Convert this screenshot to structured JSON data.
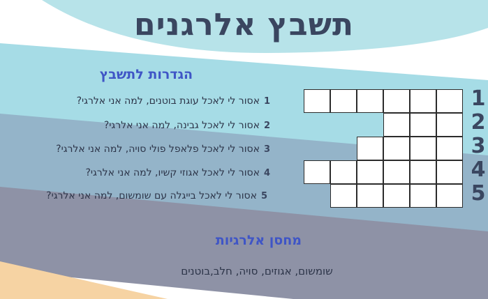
{
  "title": "תשבץ אלרגנים",
  "clues_heading": "הגדרות לתשבץ",
  "clues": [
    {
      "number": "1",
      "text": "אסור לי לאכל עוגת בוטנים, למה אני אלרגי?"
    },
    {
      "number": "2",
      "text": "אסור לי לאכל גבינה, למה אני אלרגי?"
    },
    {
      "number": "3",
      "text": "אסור לי לאכל פלאפל פולי סויה, למה אני אלרגי?"
    },
    {
      "number": "4",
      "text": "אסור לי לאכל אגוזי קשיו, למה אני אלרגי?"
    },
    {
      "number": "5",
      "text": "אסור לי לאכל בייגלה עם שומשום, למה אני אלרגי?"
    }
  ],
  "grid": {
    "columns": 6,
    "rows": [
      {
        "number": "1",
        "cells": 6
      },
      {
        "number": "2",
        "cells": 3
      },
      {
        "number": "3",
        "cells": 4
      },
      {
        "number": "4",
        "cells": 6
      },
      {
        "number": "5",
        "cells": 5
      }
    ]
  },
  "bank_heading": "מחסן אלרגיות",
  "bank_words": "שומשום, אגוזים, סויה, חלב,בוטנים",
  "colors": {
    "title": "#3a4660",
    "heading": "#3f55c6",
    "band_light": "#a6dce6",
    "band_steel": "#94b4c9",
    "band_slate": "#8e92a6",
    "band_peach": "#f6d3a3"
  }
}
